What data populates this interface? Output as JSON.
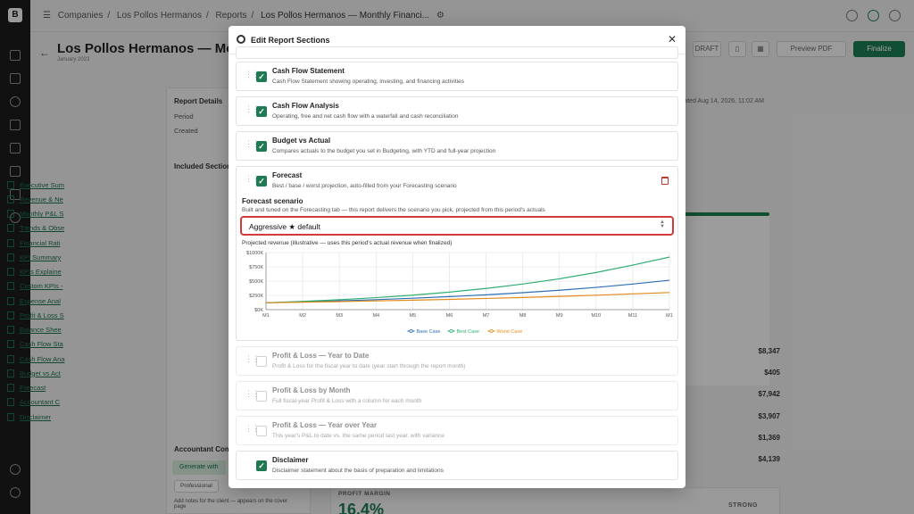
{
  "app": {
    "logo_text": "B",
    "breadcrumb": [
      "Companies",
      "Los Pollos Hermanos",
      "Reports",
      "Los Pollos Hermanos — Monthly Financi..."
    ],
    "page_title": "Los Pollos Hermanos — Monthl",
    "page_subtitle": "January 2023",
    "header_buttons": {
      "draft": "DRAFT",
      "preview": "Preview PDF",
      "finalize": "Finalize"
    }
  },
  "left_panel": {
    "report_details_heading": "Report Details",
    "period_label": "Period",
    "created_label": "Created",
    "included_heading": "Included Section",
    "included_items": [
      "Executive Sum",
      "Revenue & Ne",
      "Monthly P&L S",
      "Trends & Obse",
      "Financial Rati",
      "KPI Summary",
      "KPIs Explaine",
      "Custom KPIs -",
      "Expense Anal",
      "Profit & Loss S",
      "Balance Shee",
      "Cash Flow Sta",
      "Cash Flow Ana",
      "Budget vs Act",
      "Forecast",
      "Accountant C",
      "Disclaimer"
    ],
    "accountant_heading": "Accountant Com",
    "generate_label": "Generate with",
    "tone_professional": "Professional",
    "notes_help": "Add notes for the client — appears on the cover page"
  },
  "right_panel": {
    "generated_text": "erated Aug 14, 2026, 11:02 AM",
    "values": [
      "$8,347",
      "$405",
      "$7,942",
      "$3,907",
      "$1,369",
      "$4,139"
    ],
    "profit_margin_label": "PROFIT MARGIN",
    "profit_margin_value": "16.4%",
    "strength_label": "STRONG"
  },
  "modal": {
    "title": "Edit Report Sections",
    "sections": [
      {
        "title": "Cash Flow Statement",
        "desc": "Cash Flow Statement showing operating, investing, and financing activities",
        "checked": true
      },
      {
        "title": "Cash Flow Analysis",
        "desc": "Operating, free and net cash flow with a waterfall and cash reconciliation",
        "checked": true
      },
      {
        "title": "Budget vs Actual",
        "desc": "Compares actuals to the budget you set in Budgeting, with YTD and full-year projection",
        "checked": true
      },
      {
        "title": "Forecast",
        "desc": "Best / base / worst projection, auto-filled from your Forecasting scenario",
        "checked": true
      },
      {
        "title": "Profit & Loss — Year to Date",
        "desc": "Profit & Loss for the fiscal year to date (year start through the report month)",
        "checked": false
      },
      {
        "title": "Profit & Loss by Month",
        "desc": "Full fiscal-year Profit & Loss with a column for each month",
        "checked": false
      },
      {
        "title": "Profit & Loss — Year over Year",
        "desc": "This year's P&L to date vs. the same period last year, with variance",
        "checked": false
      },
      {
        "title": "Disclaimer",
        "desc": "Disclaimer statement about the basis of preparation and limitations",
        "checked": true
      }
    ],
    "forecast": {
      "scenario_label": "Forecast scenario",
      "scenario_help": "Built and tuned on the Forecasting tab — this report delivers the scenario you pick, projected from this period's actuals",
      "selected_scenario": "Aggressive ★ default",
      "chart_title": "Projected revenue (illustrative — uses this period's actual revenue when finalized)"
    }
  },
  "chart_data": {
    "type": "line",
    "title": "Projected revenue (illustrative — uses this period's actual revenue when finalized)",
    "categories": [
      "M1",
      "M2",
      "M3",
      "M4",
      "M5",
      "M6",
      "M7",
      "M8",
      "M9",
      "M10",
      "M11",
      "M1"
    ],
    "y_ticks": [
      "$0K",
      "$250K",
      "$500K",
      "$750K",
      "$1000K"
    ],
    "ylim": [
      0,
      1000
    ],
    "grid": true,
    "legend": "bottom",
    "series": [
      {
        "name": "Base Case",
        "color": "#2f6fb5",
        "values": [
          120,
          136,
          154,
          175,
          200,
          228,
          260,
          297,
          340,
          390,
          448,
          515
        ]
      },
      {
        "name": "Best Case",
        "color": "#2fae72",
        "values": [
          120,
          144,
          174,
          210,
          254,
          307,
          371,
          448,
          540,
          650,
          780,
          920
        ]
      },
      {
        "name": "Worst Case",
        "color": "#e48a1a",
        "values": [
          120,
          130,
          141,
          153,
          166,
          180,
          196,
          213,
          232,
          253,
          276,
          300
        ]
      }
    ]
  }
}
